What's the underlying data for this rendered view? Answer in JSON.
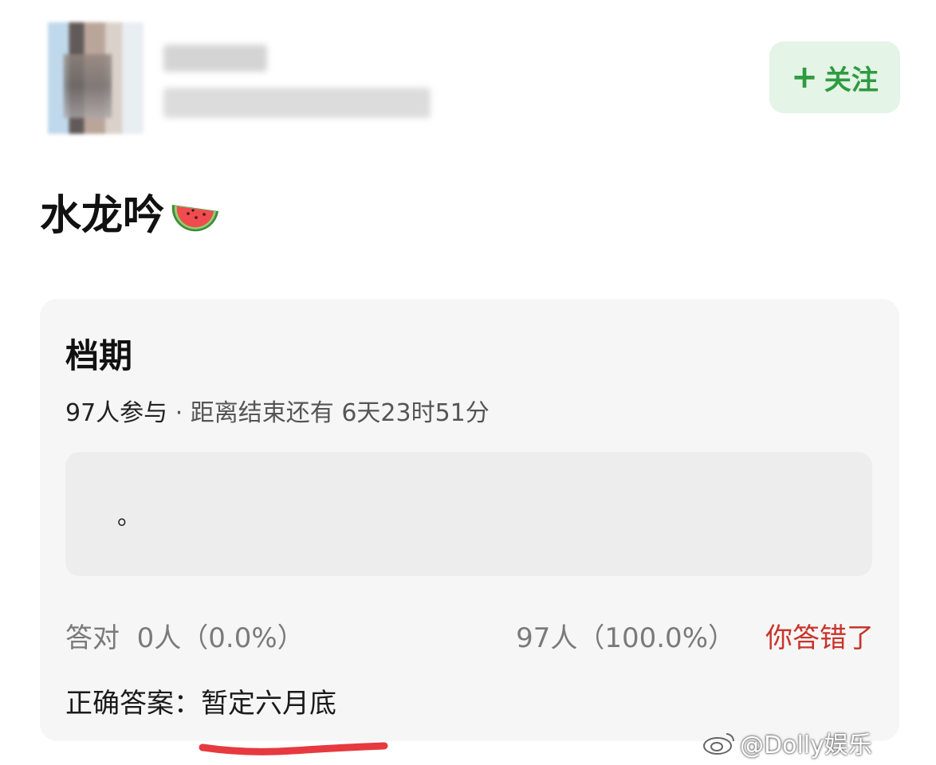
{
  "header": {
    "follow_plus": "+",
    "follow_label": "关注",
    "accent_color": "#2f9b41"
  },
  "post": {
    "title": "水龙吟",
    "emoji": "watermelon-icon"
  },
  "card": {
    "title": "档期",
    "participants": "97人参与",
    "separator": " · ",
    "remaining": "距离结束还有 6天23时51分",
    "answer_text": "。",
    "stat_correct_label": "答对",
    "stat_correct_value": "0人（0.0%）",
    "stat_other_value": "97人（100.0%）",
    "wrong_label": "你答错了",
    "correct_answer_label": "正确答案：",
    "correct_answer_value": "暂定六月底"
  },
  "watermark": {
    "text": "@Dolly娱乐"
  }
}
